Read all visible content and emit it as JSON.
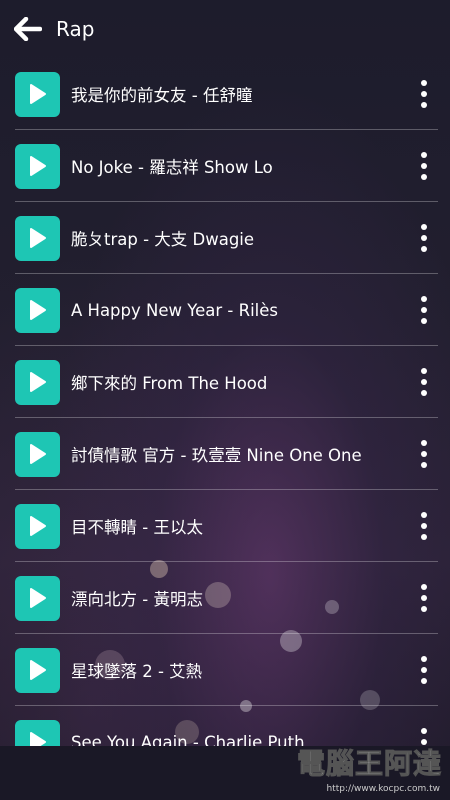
{
  "header": {
    "title": "Rap",
    "back_icon": "arrow-left-icon"
  },
  "colors": {
    "accent": "#1ec6b4",
    "background": "#1b1826",
    "text": "#ffffff"
  },
  "songs": [
    {
      "label": "我是你的前女友 - 任舒瞳"
    },
    {
      "label": "No Joke - 羅志祥 Show Lo"
    },
    {
      "label": "脆ㄆtrap - 大支 Dwagie"
    },
    {
      "label": "A Happy New Year - Rilès"
    },
    {
      "label": "鄉下來的 From The Hood"
    },
    {
      "label": "討債情歌 官方 - 玖壹壹 Nine One One"
    },
    {
      "label": "目不轉睛 - 王以太"
    },
    {
      "label": "漂向北方 - 黃明志"
    },
    {
      "label": "星球墜落 2 - 艾熱"
    },
    {
      "label": "See You Again - Charlie Puth"
    }
  ],
  "watermark": {
    "text": "電腦王阿達",
    "url": "http://www.kocpc.com.tw"
  }
}
